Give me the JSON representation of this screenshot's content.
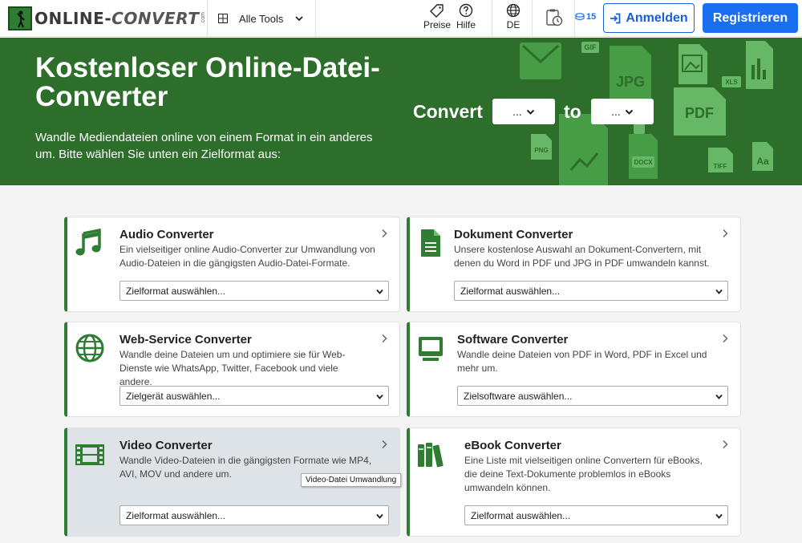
{
  "header": {
    "logo_text_a": "ONLINE-",
    "logo_text_b": "CONVERT",
    "logo_suffix": ".com",
    "all_tools": "Alle Tools",
    "prices": "Preise",
    "help": "Hilfe",
    "language": "DE",
    "credits": "15",
    "login": "Anmelden",
    "register": "Registrieren"
  },
  "hero": {
    "title": "Kostenloser Online-Datei-Converter",
    "subtitle": "Wandle Mediendateien online von einem Format in ein anderes um. Bitte wählen Sie unten ein Zielformat aus:",
    "convert_label": "Convert",
    "to_label": "to",
    "from_value": "...",
    "to_value": "...",
    "art_labels": [
      "GIF",
      "JPG",
      "XLS",
      "PDF",
      "PNG",
      "DOCX",
      "TIFF",
      "Aa"
    ]
  },
  "cards": [
    {
      "title": "Audio Converter",
      "desc": "Ein vielseitiger online Audio-Converter zur Umwandlung von Audio-Dateien in die gängigsten Audio-Datei-Formate.",
      "select": "Zielformat auswählen...",
      "icon": "music-note-icon"
    },
    {
      "title": "Dokument Converter",
      "desc": "Unsere kostenlose Auswahl an Dokument-Convertern, mit denen du Word in PDF und JPG in PDF umwandeln kannst.",
      "select": "Zielformat auswählen...",
      "icon": "document-icon"
    },
    {
      "title": "Web-Service Converter",
      "desc": "Wandle deine Dateien um und optimiere sie für Web-Dienste wie WhatsApp, Twitter, Facebook und viele andere.",
      "select": "Zielgerät auswählen...",
      "icon": "globe-icon"
    },
    {
      "title": "Software Converter",
      "desc": "Wandle deine Dateien von PDF in Word, PDF in Excel und mehr um.",
      "select": "Zielsoftware auswählen...",
      "icon": "monitor-icon"
    },
    {
      "title": "Video Converter",
      "desc": "Wandle Video-Dateien in die gängigsten Formate wie MP4, AVI, MOV und andere um.",
      "select": "Zielformat auswählen...",
      "icon": "film-icon"
    },
    {
      "title": "eBook Converter",
      "desc": "Eine Liste mit vielseitigen online Convertern für eBooks, die deine Text-Dokumente problemlos in eBooks umwandeln können.",
      "select": "Zielformat auswählen...",
      "icon": "books-icon"
    }
  ],
  "tooltip": "Video-Datei Umwandlung",
  "colors": {
    "brand_green": "#2d6e2b",
    "accent_blue": "#1a6ef0",
    "icon_green": "#2e7d32"
  }
}
